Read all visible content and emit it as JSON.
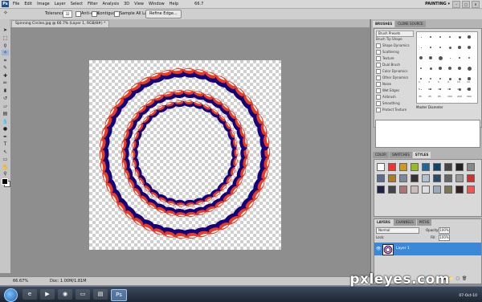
{
  "menubar": {
    "logo": "Ps",
    "items": [
      "File",
      "Edit",
      "Image",
      "Layer",
      "Select",
      "Filter",
      "Analysis",
      "3D",
      "View",
      "Window",
      "Help"
    ],
    "zoom": "66.7",
    "workspace": "PAINTING ▾",
    "window_buttons": [
      "–",
      "□",
      "✕"
    ]
  },
  "options_bar": {
    "tolerance_label": "Tolerance:",
    "tolerance_value": "32",
    "anti_alias": "Anti-alias",
    "contiguous": "Contiguous",
    "sample_all_layers": "Sample All Layers",
    "refine_edge": "Refine Edge..."
  },
  "document": {
    "tab_title": "Spinning Circles.jpg @ 66.7% (Layer 1, RGB/8#) *",
    "canvas_transparent": true
  },
  "status_bar": {
    "zoom": "66.67%",
    "doc": "Doc: 1.00M/1.81M"
  },
  "panels": {
    "brushes_tabs": [
      "BRUSHES",
      "CLONE SOURCE"
    ],
    "brush_presets_button": "Brush Presets",
    "brush_options": [
      "Brush Tip Shape",
      "Shape Dynamics",
      "Scattering",
      "Texture",
      "Dual Brush",
      "Color Dynamics",
      "Other Dynamics",
      "Noise",
      "Wet Edges",
      "Airbrush",
      "Smoothing",
      "Protect Texture"
    ],
    "brush_sizes": [
      "1",
      "3",
      "5",
      "9",
      "13",
      "19",
      "5",
      "9",
      "13",
      "17",
      "21",
      "27",
      "35",
      "45",
      "65",
      "100",
      "200",
      "300"
    ],
    "master_diameter": "Master Diameter",
    "styles_tabs": [
      "COLOR",
      "SWATCHES",
      "STYLES"
    ],
    "layers_tabs": [
      "LAYERS",
      "CHANNELS",
      "PATHS"
    ],
    "blend_mode": "Normal",
    "opacity_label": "Opacity:",
    "opacity_value": "100%",
    "lock_label": "Lock:",
    "fill_label": "Fill:",
    "fill_value": "100%",
    "layer_name": "Layer 1",
    "footer_icons": [
      "🔗",
      "fx",
      "◐",
      "▣",
      "📁",
      "▢",
      "🗑"
    ]
  },
  "taskbar": {
    "clock_time": "",
    "clock_date": "07-Oct-10"
  },
  "watermark": "pxleyes.com",
  "colors": {
    "ring_red": "#ee3b1f",
    "ring_blue": "#13007a",
    "layer_selected": "#3a88d8"
  }
}
